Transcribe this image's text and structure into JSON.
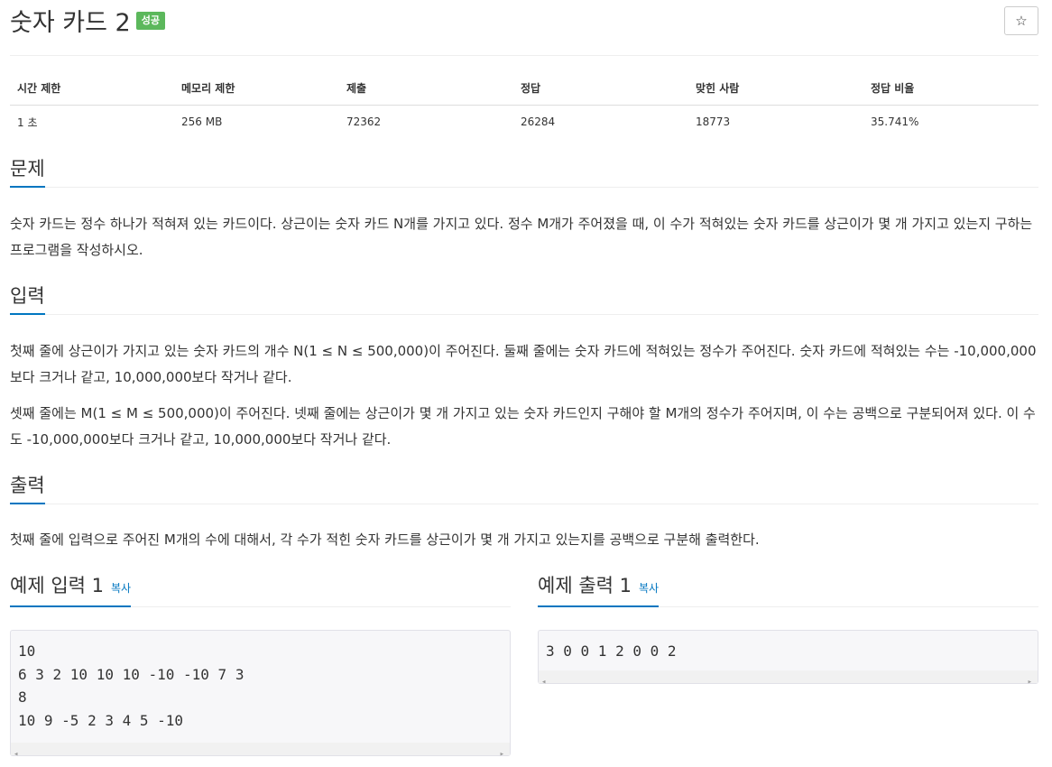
{
  "problem": {
    "title": "숫자 카드 2",
    "badge": "성공",
    "star": "☆"
  },
  "info_table": {
    "headers": [
      "시간 제한",
      "메모리 제한",
      "제출",
      "정답",
      "맞힌 사람",
      "정답 비율"
    ],
    "values": [
      "1 초",
      "256 MB",
      "72362",
      "26284",
      "18773",
      "35.741%"
    ]
  },
  "sections": {
    "problem": {
      "heading": "문제",
      "paragraphs": [
        "숫자 카드는 정수 하나가 적혀져 있는 카드이다. 상근이는 숫자 카드 N개를 가지고 있다. 정수 M개가 주어졌을 때, 이 수가 적혀있는 숫자 카드를 상근이가 몇 개 가지고 있는지 구하는 프로그램을 작성하시오."
      ]
    },
    "input": {
      "heading": "입력",
      "paragraphs": [
        "첫째 줄에 상근이가 가지고 있는 숫자 카드의 개수 N(1 ≤ N ≤ 500,000)이 주어진다. 둘째 줄에는 숫자 카드에 적혀있는 정수가 주어진다. 숫자 카드에 적혀있는 수는 -10,000,000보다 크거나 같고, 10,000,000보다 작거나 같다.",
        "셋째 줄에는 M(1 ≤ M ≤ 500,000)이 주어진다. 넷째 줄에는 상근이가 몇 개 가지고 있는 숫자 카드인지 구해야 할 M개의 정수가 주어지며, 이 수는 공백으로 구분되어져 있다. 이 수도 -10,000,000보다 크거나 같고, 10,000,000보다 작거나 같다."
      ]
    },
    "output": {
      "heading": "출력",
      "paragraphs": [
        "첫째 줄에 입력으로 주어진 M개의 수에 대해서, 각 수가 적힌 숫자 카드를 상근이가 몇 개 가지고 있는지를 공백으로 구분해 출력한다."
      ]
    }
  },
  "samples": {
    "input": {
      "heading": "예제 입력 1",
      "copy": "복사",
      "code": "10\n6 3 2 10 10 10 -10 -10 7 3\n8\n10 9 -5 2 3 4 5 -10"
    },
    "output": {
      "heading": "예제 출력 1",
      "copy": "복사",
      "code": "3 0 0 1 2 0 0 2"
    },
    "scroll_left": "◂",
    "scroll_right": "▸"
  }
}
